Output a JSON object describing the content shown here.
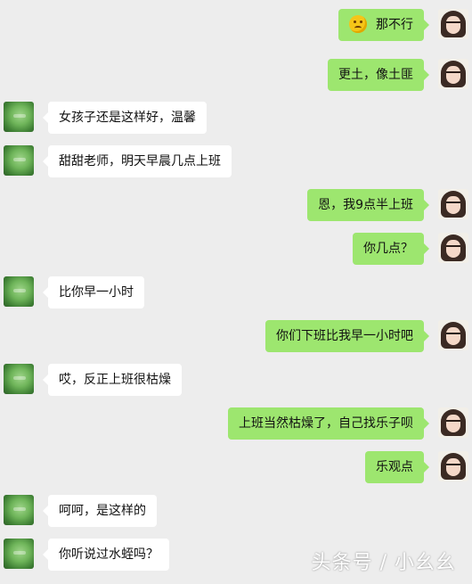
{
  "messages": [
    {
      "side": "right",
      "text": "那不行",
      "emoji": "thinking-emoji-icon"
    },
    {
      "side": "right",
      "text": "更土，像土匪"
    },
    {
      "side": "left",
      "text": "女孩子还是这样好，温馨"
    },
    {
      "side": "left",
      "text": "甜甜老师，明天早晨几点上班"
    },
    {
      "side": "right",
      "text": "恩，我9点半上班"
    },
    {
      "side": "right",
      "text": "你几点？"
    },
    {
      "side": "left",
      "text": "比你早一小时"
    },
    {
      "side": "right",
      "text": "你们下班比我早一小时吧"
    },
    {
      "side": "left",
      "text": "哎，反正上班很枯燥"
    },
    {
      "side": "right",
      "text": "上班当然枯燥了，自己找乐子呗"
    },
    {
      "side": "right",
      "text": "乐观点"
    },
    {
      "side": "left",
      "text": "呵呵，是这样的"
    },
    {
      "side": "left",
      "text": "你听说过水蛭吗？"
    }
  ],
  "watermark": "头条号 / 小幺幺",
  "colors": {
    "background": "#ededed",
    "sent_bubble": "#9de66f",
    "received_bubble": "#ffffff"
  }
}
